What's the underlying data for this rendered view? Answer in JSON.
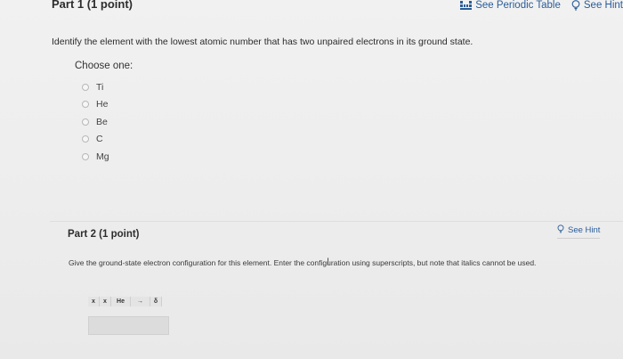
{
  "part1": {
    "title": "Part 1   (1 point)",
    "links": {
      "periodic_table": "See Periodic Table",
      "hint": "See Hint"
    },
    "question": "Identify the element with the lowest atomic number that has two unpaired electrons in its ground state.",
    "choose_label": "Choose one:",
    "options": [
      "Ti",
      "He",
      "Be",
      "C",
      "Mg"
    ]
  },
  "part2": {
    "title": "Part 2   (1 point)",
    "hint": "See Hint",
    "instruction": "Give the ground-state electron configuration for this element. Enter the configuration using superscripts, but note that italics cannot be used.",
    "toolbar": [
      "x",
      "x",
      "He",
      "→",
      "δ"
    ]
  },
  "colors": {
    "link": "#2a5c98",
    "background": "#ededed",
    "answer_box": "#dcdcdc"
  }
}
